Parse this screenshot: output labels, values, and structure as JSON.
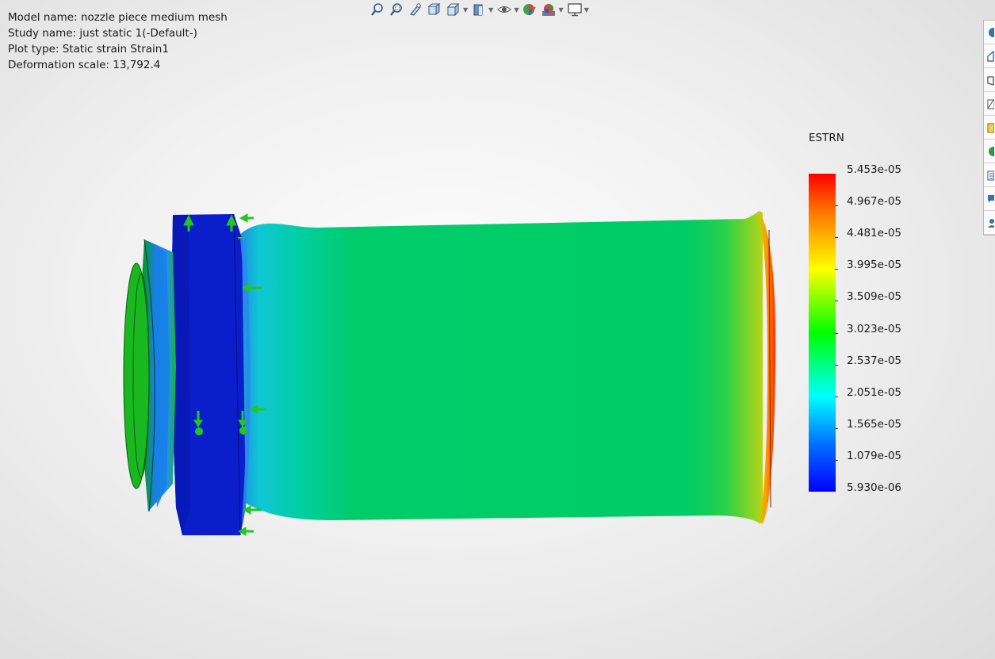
{
  "info": {
    "model_name": "Model name: nozzle piece medium mesh",
    "study_name": "Study name: just static 1(-Default-)",
    "plot_type": "Plot type: Static strain Strain1",
    "deformation_scale": "Deformation scale: 13,792.4"
  },
  "toolbar": {
    "items": [
      {
        "icon": "zoom-to-fit-icon"
      },
      {
        "icon": "zoom-to-area-icon"
      },
      {
        "icon": "previous-view-icon"
      },
      {
        "icon": "section-view-icon"
      },
      {
        "icon": "view-orientation-icon",
        "dropdown": true
      },
      {
        "icon": "display-style-icon",
        "dropdown": true
      },
      {
        "icon": "hide-show-items-icon",
        "dropdown": true
      },
      {
        "icon": "edit-appearance-icon"
      },
      {
        "icon": "apply-scene-icon",
        "dropdown": true
      },
      {
        "icon": "view-settings-icon",
        "dropdown": true
      }
    ]
  },
  "right_panel": {
    "items": [
      "globe-icon",
      "home-icon",
      "part-icon",
      "sketch-icon",
      "property-icon",
      "appearance-icon",
      "list-icon",
      "comment-icon",
      "person-icon"
    ]
  },
  "legend": {
    "title": "ESTRN",
    "labels": [
      "5.453e-05",
      "4.967e-05",
      "4.481e-05",
      "3.995e-05",
      "3.509e-05",
      "3.023e-05",
      "2.537e-05",
      "2.051e-05",
      "1.565e-05",
      "1.079e-05",
      "5.930e-06"
    ],
    "colors": {
      "max": "#ff0000",
      "min": "#0000ff"
    }
  },
  "plot": {
    "colors": {
      "body": "#00cc66",
      "flange": "#0a1ecc",
      "fixture_arrow": "#22c81e"
    }
  }
}
